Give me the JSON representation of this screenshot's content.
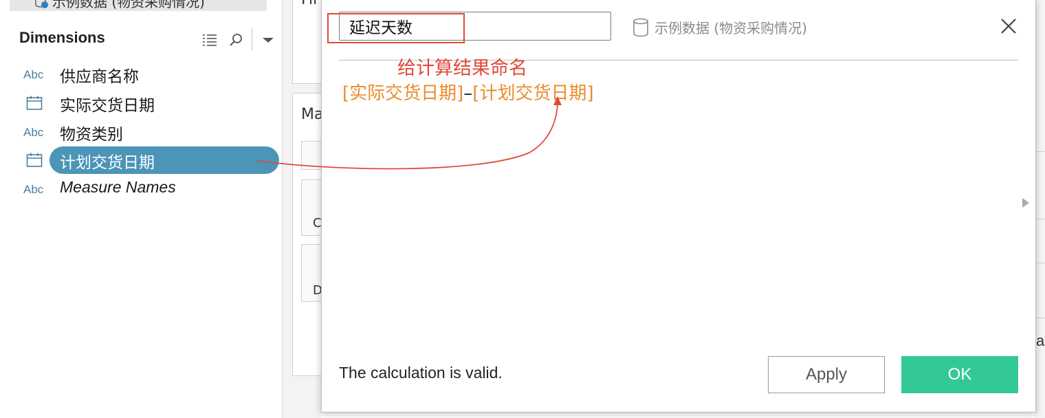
{
  "data_pane": {
    "source_label": "示例数据 (物资采购情况)",
    "dimensions_header": "Dimensions",
    "fields": [
      {
        "type": "Abc",
        "name": "供应商名称"
      },
      {
        "type": "date",
        "name": "实际交货日期"
      },
      {
        "type": "Abc",
        "name": "物资类别"
      },
      {
        "type": "date",
        "name": "计划交货日期",
        "selected": true
      },
      {
        "type": "Abc",
        "name": "Measure Names",
        "italic": true
      }
    ]
  },
  "background": {
    "card1_text": "Fil",
    "card2_text": "Ma",
    "mini_letter_1": "C",
    "mini_letter_2": "D",
    "right_edge_letter": "a"
  },
  "dialog": {
    "calc_name": "延迟天数",
    "source": "示例数据 (物资采购情况)",
    "annotation": "给计算结果命名",
    "formula_part1": "[实际交货日期]",
    "formula_operator": "–",
    "formula_part2": "[计划交货日期]",
    "status": "The calculation is valid.",
    "apply_label": "Apply",
    "ok_label": "OK"
  },
  "colors": {
    "annotation_red": "#e0493a",
    "formula_orange": "#ec8a2c",
    "ok_green": "#33c997",
    "selected_pill": "#4b95b8"
  }
}
